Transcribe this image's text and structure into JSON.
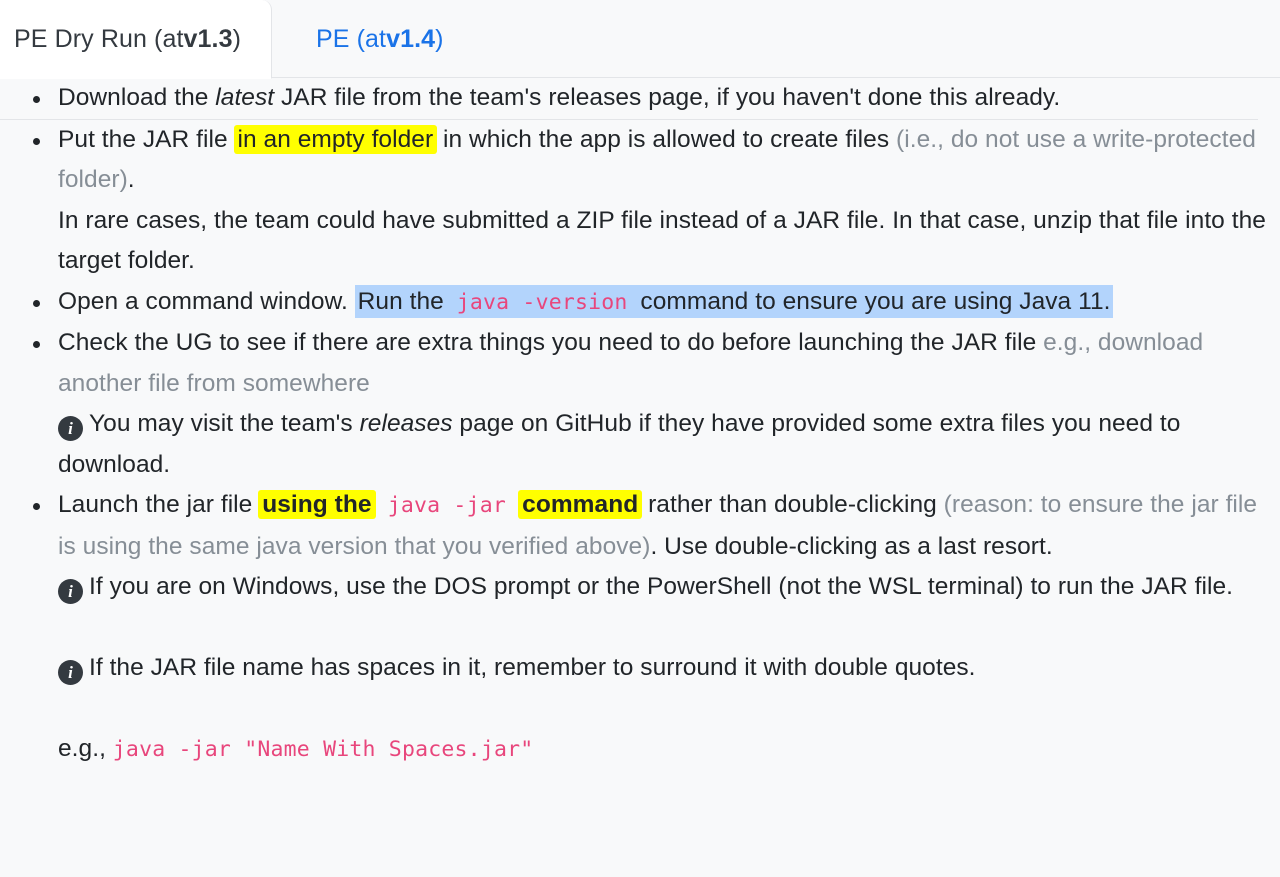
{
  "colors": {
    "background": "#f8f9fa",
    "active_tab_bg": "#ffffff",
    "link_blue": "#1a73e8",
    "highlight_yellow": "#ffff00",
    "highlight_blue": "#b3d4fc",
    "code_pink": "#e8467c",
    "muted_gray": "#868e96",
    "text": "#212529",
    "border": "#e3e5e8"
  },
  "tabs": [
    {
      "id": "pe-dry-run",
      "prefix": "PE Dry Run (at ",
      "version": "v1.3",
      "suffix": ")",
      "active": true
    },
    {
      "id": "pe",
      "prefix": "PE (at ",
      "version": "v1.4",
      "suffix": ")",
      "active": false
    }
  ],
  "content": {
    "first_block": {
      "bullet_1": {
        "part_1": "Download the ",
        "italic": "latest",
        "part_2": " JAR file from the team's releases page, if you haven't done this already."
      }
    },
    "second_block": {
      "bullet_1": {
        "part_1": "Put the JAR file ",
        "highlight": "in an empty folder",
        "part_2": " in which the app is allowed to create files ",
        "muted": "(i.e., do not use a write-protected folder)",
        "part_3": ".",
        "sub_line": "In rare cases, the team could have submitted a ZIP file instead of a JAR file. In that case, unzip that file into the target folder."
      },
      "bullet_2": {
        "part_1": "Open a command window. ",
        "sel_1": "Run the ",
        "code": "java -version",
        "sel_2": " command to ensure you are using Java 11."
      },
      "bullet_3": {
        "part_1": "Check the UG to see if there are extra things you need to do before launching the JAR file ",
        "muted": "e.g., download another file from somewhere",
        "note_icon": "info-icon",
        "note_part_1": "You may visit the team's ",
        "note_italic": "releases",
        "note_part_2": " page on GitHub if they have provided some extra files you need to download."
      },
      "bullet_4": {
        "part_1": "Launch the jar file ",
        "highlight_1": "using the",
        "code": " java -jar ",
        "highlight_2": "command",
        "part_2": " rather than double-clicking ",
        "muted": "(reason: to ensure the jar file is using the same java version that you verified above)",
        "part_3": ". Use double-clicking as a last resort.",
        "note_1_icon": "info-icon",
        "note_1": "If you are on Windows, use the DOS prompt or the PowerShell (not the WSL terminal) to run the JAR file.",
        "note_2_icon": "info-icon",
        "note_2": "If the JAR file name has spaces in it, remember to surround it with double quotes.",
        "example_label": "e.g., ",
        "example_code": "java -jar \"Name With Spaces.jar\""
      }
    }
  }
}
